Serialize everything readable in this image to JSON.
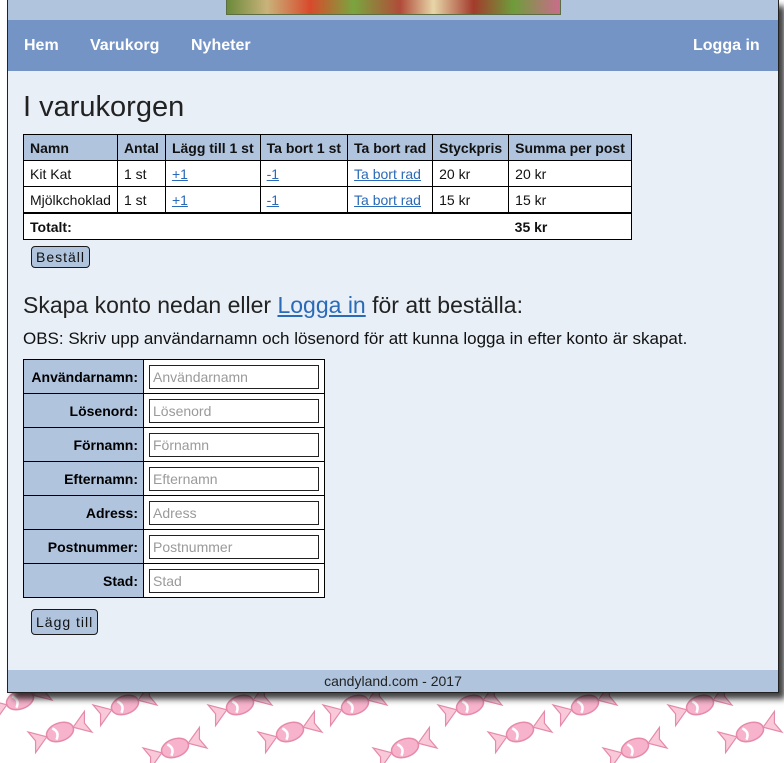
{
  "nav": {
    "home": "Hem",
    "cart": "Varukorg",
    "news": "Nyheter",
    "login": "Logga in"
  },
  "cart": {
    "title": "I varukorgen",
    "headers": [
      "Namn",
      "Antal",
      "Lägg till 1 st",
      "Ta bort 1 st",
      "Ta bort rad",
      "Styckpris",
      "Summa per post"
    ],
    "rows": [
      {
        "name": "Kit Kat",
        "qty": "1 st",
        "add": "+1",
        "remove": "-1",
        "remove_row": "Ta bort rad",
        "unit_price": "20 kr",
        "subtotal": "20 kr"
      },
      {
        "name": "Mjölkchoklad",
        "qty": "1 st",
        "add": "+1",
        "remove": "-1",
        "remove_row": "Ta bort rad",
        "unit_price": "15 kr",
        "subtotal": "15 kr"
      }
    ],
    "total_label": "Totalt:",
    "total_value": "35 kr",
    "order_button": "Beställ"
  },
  "signup": {
    "heading_before": "Skapa konto nedan eller ",
    "heading_link": "Logga in",
    "heading_after": " för att beställa:",
    "note": "OBS: Skriv upp användarnamn och lösenord för att kunna logga in efter konto är skapat.",
    "fields": [
      {
        "label": "Användarnamn:",
        "placeholder": "Användarnamn",
        "value": ""
      },
      {
        "label": "Lösenord:",
        "placeholder": "Lösenord",
        "value": ""
      },
      {
        "label": "Förnamn:",
        "placeholder": "Förnamn",
        "value": ""
      },
      {
        "label": "Efternamn:",
        "placeholder": "Efternamn",
        "value": ""
      },
      {
        "label": "Adress:",
        "placeholder": "Adress",
        "value": ""
      },
      {
        "label": "Postnummer:",
        "placeholder": "Postnummer",
        "value": ""
      },
      {
        "label": "Stad:",
        "placeholder": "Stad",
        "value": ""
      }
    ],
    "submit_button": "Lägg till"
  },
  "footer": {
    "text": "candyland.com - 2017"
  },
  "colors": {
    "navbar": "#7494c6",
    "header_bg": "#b0c4de",
    "page_bg": "#e8eff7",
    "link": "#2a6ab7",
    "wallpaper_candy": "#f4a6c4"
  },
  "icons": {
    "wallpaper": "candy-icon",
    "banner": "vegetables-banner-image"
  }
}
